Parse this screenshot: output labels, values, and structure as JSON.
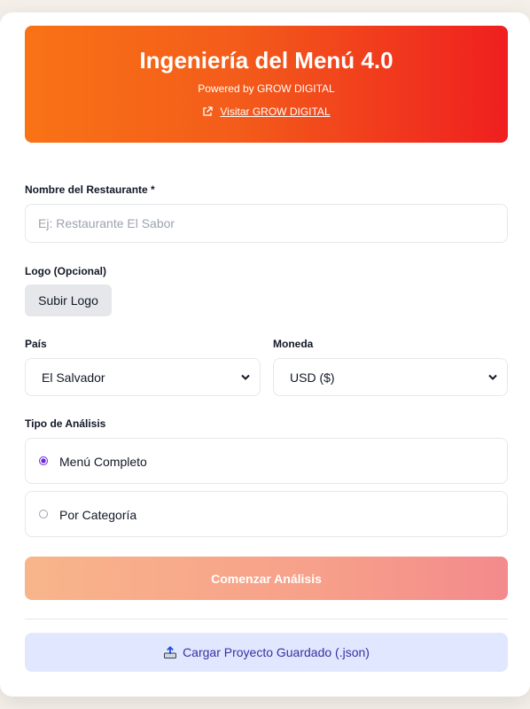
{
  "header": {
    "title": "Ingeniería del Menú 4.0",
    "subtitle": "Powered by GROW DIGITAL",
    "link_label": "Visitar GROW DIGITAL",
    "link_icon": "external-link-icon"
  },
  "form": {
    "restaurant_label": "Nombre del Restaurante *",
    "restaurant_placeholder": "Ej: Restaurante El Sabor",
    "restaurant_value": "",
    "logo_label": "Logo (Opcional)",
    "logo_button": "Subir Logo",
    "country_label": "País",
    "country_value": "El Salvador",
    "currency_label": "Moneda",
    "currency_value": "USD ($)",
    "analysis_label": "Tipo de Análisis",
    "analysis_options": [
      {
        "label": "Menú Completo",
        "selected": true
      },
      {
        "label": "Por Categoría",
        "selected": false
      }
    ],
    "start_button": "Comenzar Análisis",
    "load_button": "Cargar Proyecto Guardado (.json)",
    "load_icon": "upload-tray-icon"
  },
  "colors": {
    "header_gradient_start": "#f97316",
    "header_gradient_end": "#ef1f1f",
    "radio_accent": "#6d28d9",
    "load_button_bg": "#e0e7ff",
    "load_button_text": "#3730a3"
  }
}
